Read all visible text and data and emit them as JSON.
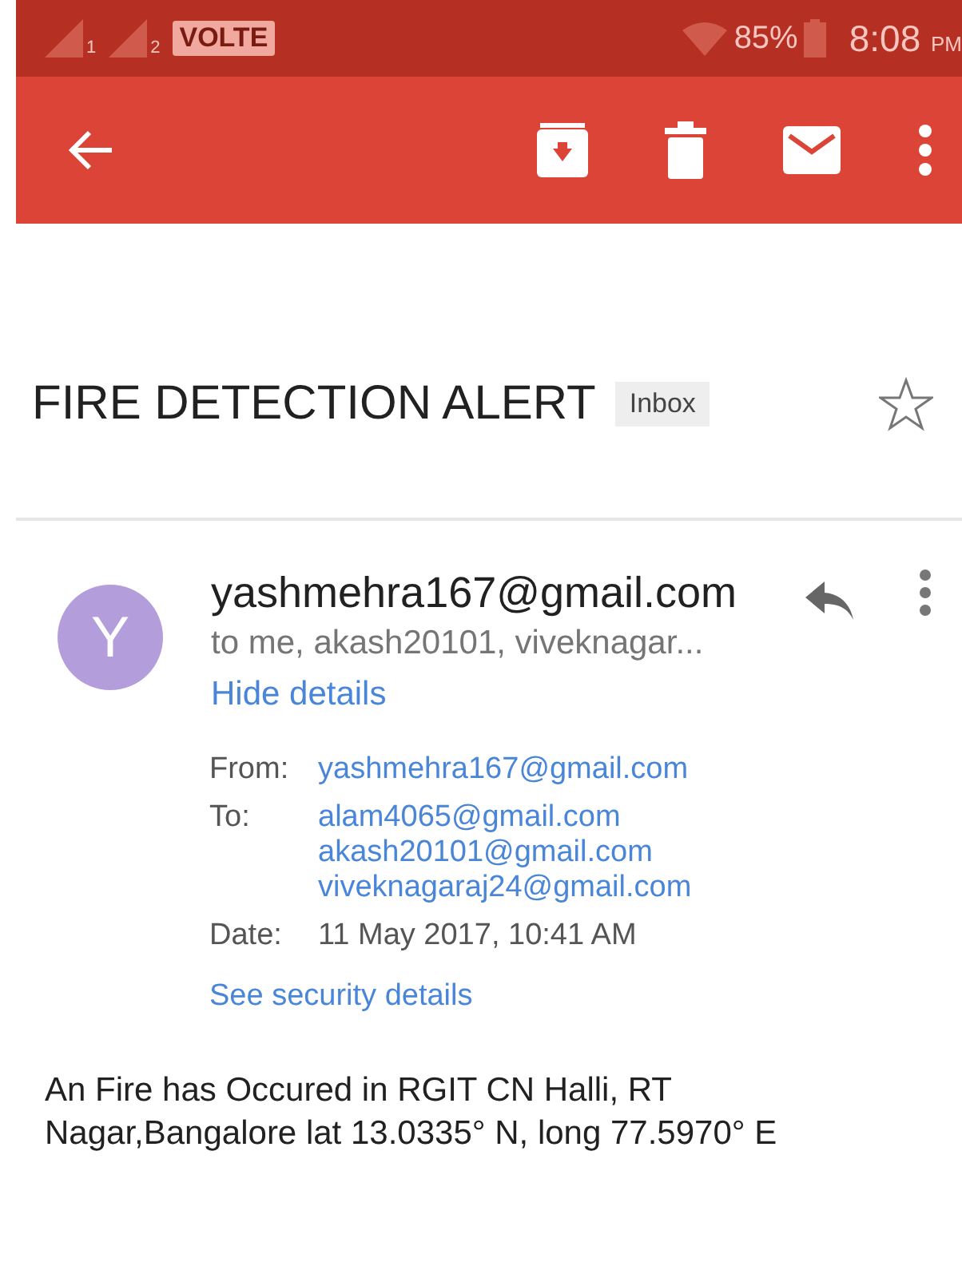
{
  "status_bar": {
    "sims": [
      "1",
      "2"
    ],
    "network": "VOLTE",
    "battery": "85%",
    "time": "8:08",
    "ampm": "PM"
  },
  "toolbar": {
    "actions": [
      {
        "kind": "archive"
      },
      {
        "kind": "delete"
      },
      {
        "kind": "mail"
      },
      {
        "kind": "more"
      }
    ]
  },
  "subject": {
    "title": "FIRE DETECTION ALERT",
    "label": "Inbox",
    "starred": false
  },
  "message": {
    "avatar": "Y",
    "sender": "yashmehra167@gmail.com",
    "recipients": "to me, akash20101, viveknagar...",
    "toggle": "Hide details",
    "details": [
      {
        "label": "From:",
        "values": [
          "yashmehra167@gmail.com"
        ]
      },
      {
        "label": "To:",
        "values": [
          "alam4065@gmail.com",
          "akash20101@gmail.com",
          "viveknagaraj24@gmail.com"
        ]
      },
      {
        "label": "Date:",
        "values": [
          "11 May 2017, 10:41 AM"
        ],
        "kind": "plain"
      }
    ],
    "security": "See security details",
    "body": "An Fire has Occured in RGIT CN Halli, RT Nagar,Bangalore  lat 13.0335° N, long 77.5970° E"
  }
}
